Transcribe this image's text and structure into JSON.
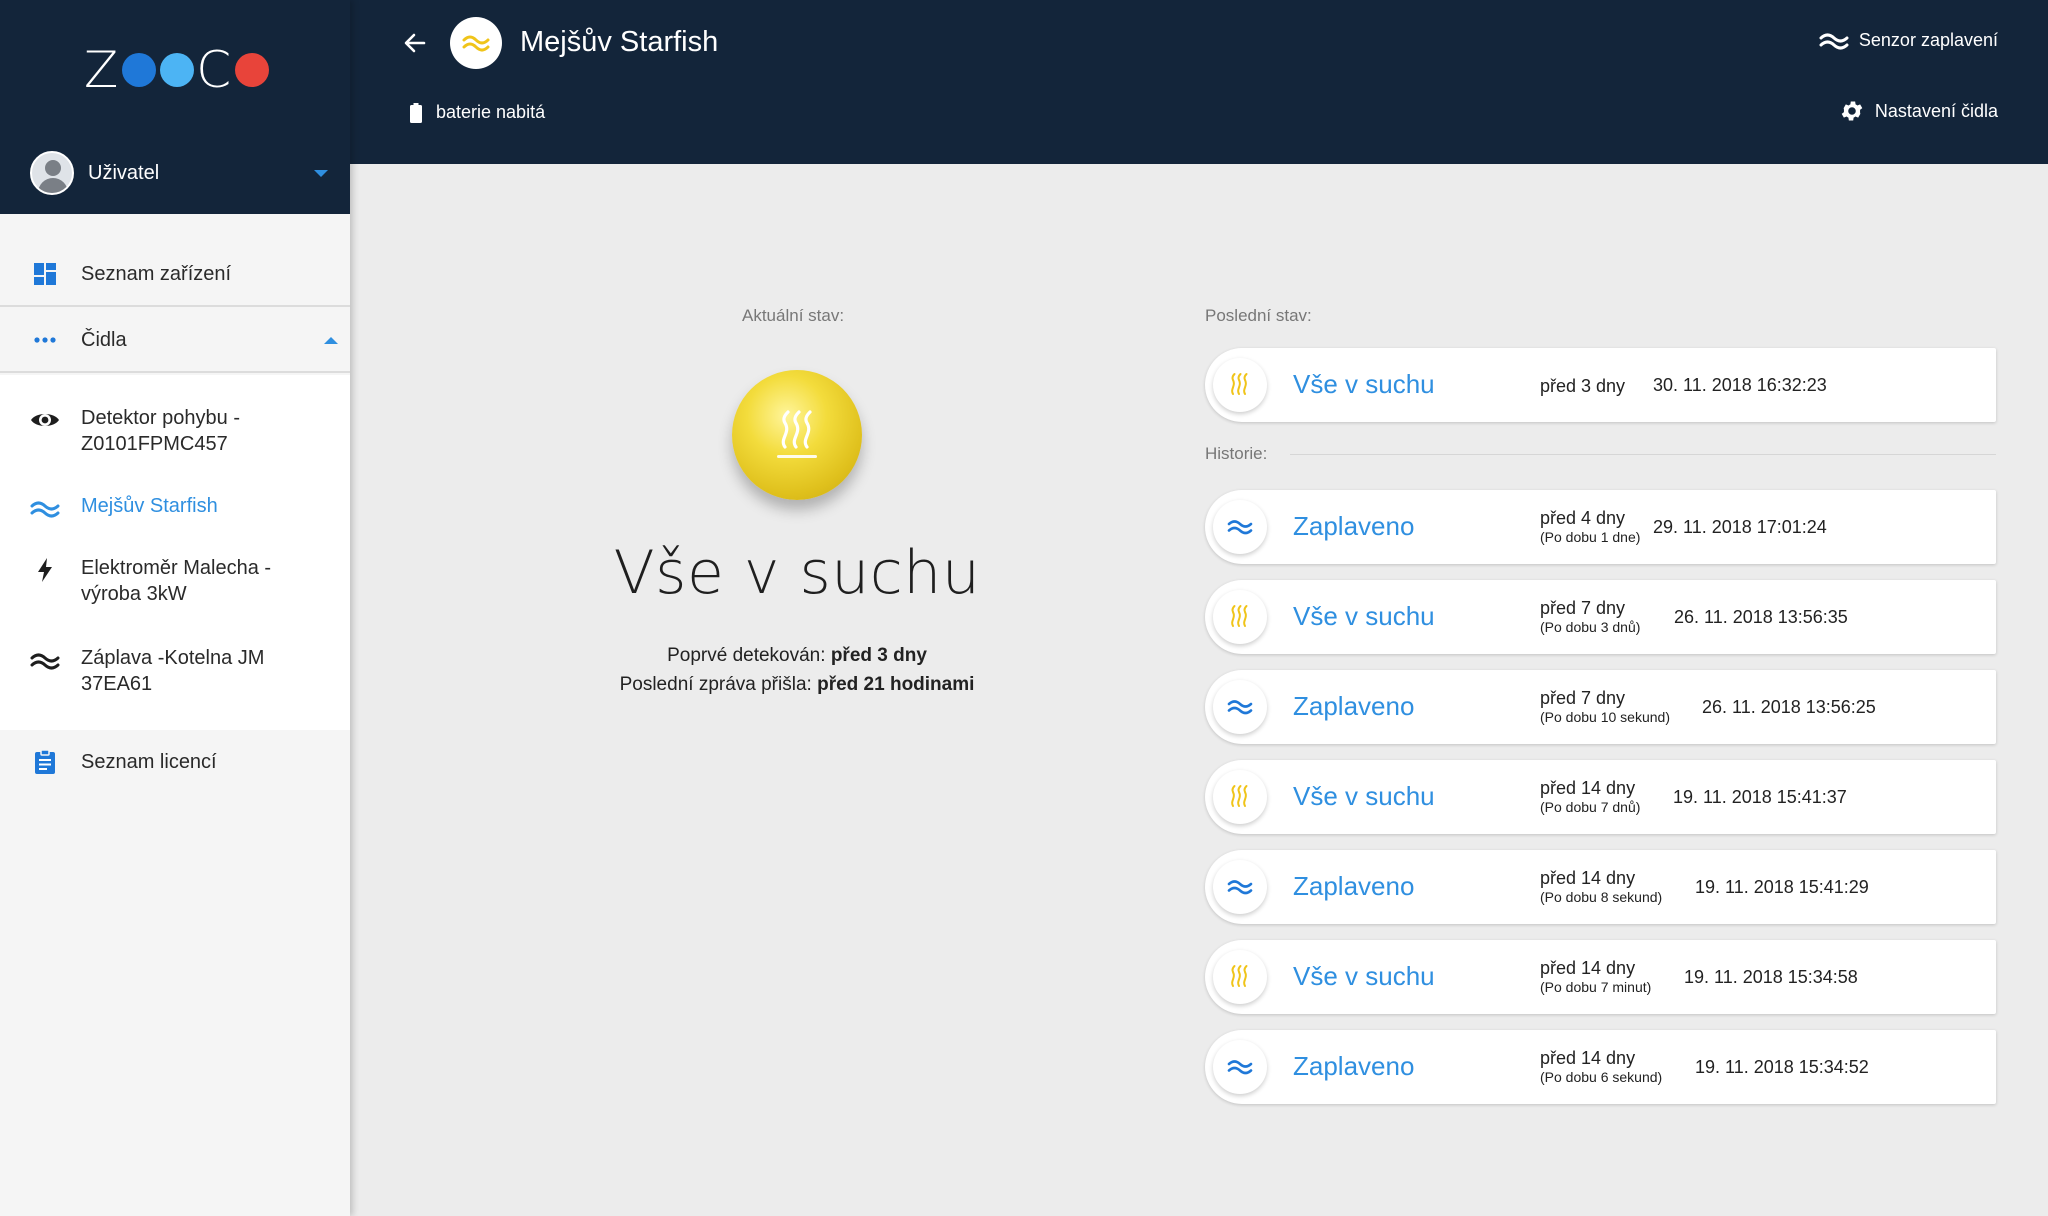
{
  "brand": {
    "logo_z": "Z",
    "logo_c": "C",
    "dot_colors": [
      "#1f78d8",
      "#4cb4f4",
      "#e8443a"
    ]
  },
  "colors": {
    "header_bg": "#13253a",
    "accent_blue": "#2f8fe0",
    "dry_yellow": "#f0c419"
  },
  "user": {
    "name": "Uživatel"
  },
  "sidebar": {
    "devices_label": "Seznam zařízení",
    "sensors_label": "Čidla",
    "sensors": [
      {
        "label": "Detektor pohybu - Z0101FPMC457",
        "icon": "eye-icon"
      },
      {
        "label": "Mejšův Starfish",
        "icon": "water-waves-icon",
        "active": true
      },
      {
        "label": "Elektroměr Malecha - výroba 3kW",
        "icon": "lightning-icon"
      },
      {
        "label": "Záplava -Kotelna JM 37EA61",
        "icon": "water-waves-icon"
      }
    ],
    "licenses_label": "Seznam licencí"
  },
  "header": {
    "title": "Mejšův Starfish",
    "battery": "baterie nabitá",
    "sensor_type": "Senzor zaplavení",
    "settings": "Nastavení čidla"
  },
  "current": {
    "label": "Aktuální stav:",
    "state": "Vše v suchu",
    "first_detected_label": "Poprvé detekován:",
    "first_detected_value": "před 3 dny",
    "last_message_label": "Poslední zpráva přišla:",
    "last_message_value": "před 21 hodinami"
  },
  "last_state": {
    "label": "Poslední stav:",
    "state": "Vše v suchu",
    "ago": "před 3 dny",
    "date": "30. 11. 2018 16:32:23",
    "kind": "dry"
  },
  "history": {
    "label": "Historie:",
    "items": [
      {
        "state": "Zaplaveno",
        "ago": "před 4 dny",
        "duration": "(Po dobu 1 dne)",
        "date": "29. 11. 2018 17:01:24",
        "kind": "flood"
      },
      {
        "state": "Vše v suchu",
        "ago": "před 7 dny",
        "duration": "(Po dobu 3 dnů)",
        "date": "26. 11. 2018 13:56:35",
        "kind": "dry"
      },
      {
        "state": "Zaplaveno",
        "ago": "před 7 dny",
        "duration": "(Po dobu 10 sekund)",
        "date": "26. 11. 2018 13:56:25",
        "kind": "flood"
      },
      {
        "state": "Vše v suchu",
        "ago": "před 14 dny",
        "duration": "(Po dobu 7 dnů)",
        "date": "19. 11. 2018 15:41:37",
        "kind": "dry"
      },
      {
        "state": "Zaplaveno",
        "ago": "před 14 dny",
        "duration": "(Po dobu 8 sekund)",
        "date": "19. 11. 2018 15:41:29",
        "kind": "flood"
      },
      {
        "state": "Vše v suchu",
        "ago": "před 14 dny",
        "duration": "(Po dobu 7 minut)",
        "date": "19. 11. 2018 15:34:58",
        "kind": "dry"
      },
      {
        "state": "Zaplaveno",
        "ago": "před 14 dny",
        "duration": "(Po dobu 6 sekund)",
        "date": "19. 11. 2018 15:34:52",
        "kind": "flood"
      }
    ]
  }
}
